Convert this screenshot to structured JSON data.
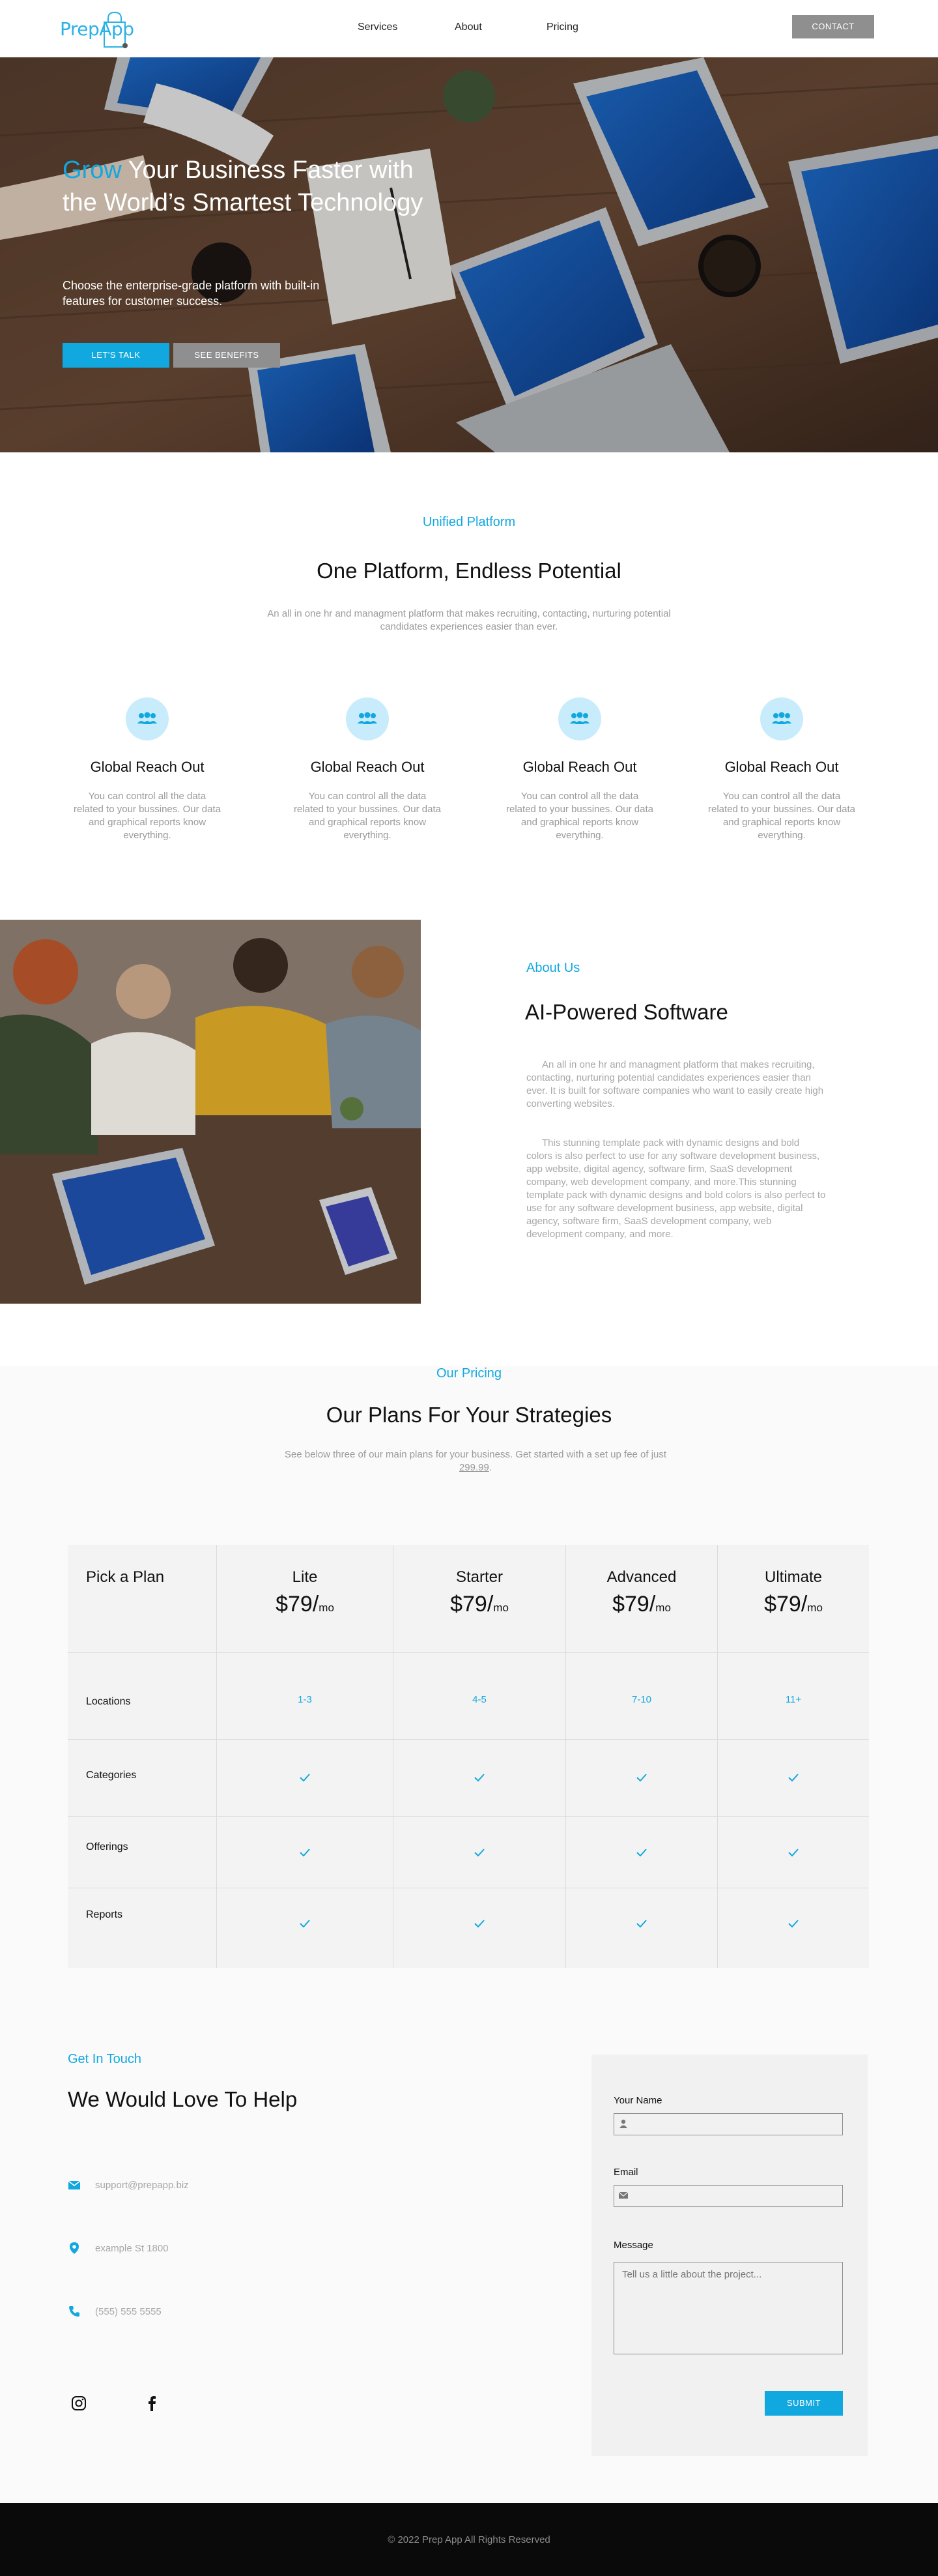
{
  "nav": {
    "logo_text": "PrepApp",
    "links": [
      "Services",
      "About",
      "Pricing"
    ],
    "contact_label": "CONTACT"
  },
  "hero": {
    "title_highlight": "Grow",
    "title_rest": " Your Business Faster with the World’s Smartest Technology",
    "subtitle": "Choose the enterprise-grade platform with built-in features for customer success.",
    "primary_button": "LET'S TALK",
    "secondary_button": "SEE BENEFITS"
  },
  "unified": {
    "eyebrow": "Unified Platform",
    "title": "One Platform, Endless Potential",
    "description": "An all in one hr and managment platform that makes recruiting, contacting, nurturing potential candidates experiences easier than ever.",
    "features": [
      {
        "title": "Global Reach Out",
        "desc": "You can control all the data related to your bussines.  Our data and graphical reports know everything.",
        "icon": "team-icon"
      },
      {
        "title": "Global Reach Out",
        "desc": "You can control all the data related to your bussines.  Our data and graphical reports know everything.",
        "icon": "team-icon"
      },
      {
        "title": "Global Reach Out",
        "desc": "You can control all the data related to your bussines.  Our data and graphical reports know everything.",
        "icon": "team-icon"
      },
      {
        "title": "Global Reach Out",
        "desc": "You can control all the data related to your bussines.  Our data and graphical reports know everything.",
        "icon": "team-icon"
      }
    ]
  },
  "about": {
    "eyebrow": "About Us",
    "title": "AI-Powered Software",
    "paragraph1": "An all in one hr and managment platform that makes recruiting, contacting, nurturing potential candidates experiences easier than ever. It is built for software companies who want to easily create high converting websites.",
    "paragraph2": "This stunning template pack with dynamic designs and bold colors is also perfect to use for any software development business, app website, digital agency, software firm, SaaS development company, web development company, and more.This stunning template pack with dynamic designs and bold colors is also perfect to use for any software development business, app website, digital agency, software firm, SaaS development company, web development company, and more."
  },
  "pricing": {
    "eyebrow": "Our Pricing",
    "title": "Our Plans For Your Strategies",
    "description_pre": "See below three of our main plans for your business. Get started with a set up fee of just ",
    "description_fee": "299.99",
    "description_post": ".",
    "pick_label": "Pick a Plan",
    "plans": [
      {
        "name": "Lite",
        "price": "$79/",
        "unit": "mo",
        "locations": "1-3"
      },
      {
        "name": "Starter",
        "price": "$79/",
        "unit": "mo",
        "locations": "4-5"
      },
      {
        "name": "Advanced",
        "price": "$79/",
        "unit": "mo",
        "locations": "7-10"
      },
      {
        "name": "Ultimate",
        "price": "$79/",
        "unit": "mo",
        "locations": "11+"
      }
    ],
    "rows": [
      "Locations",
      "Categories",
      "Offerings",
      "Reports"
    ]
  },
  "contact": {
    "eyebrow": "Get In Touch",
    "title": "We Would Love To Help",
    "email": "support@prepapp.biz",
    "address": "example St 1800",
    "phone": "(555) 555 5555",
    "form": {
      "name_label": "Your Name",
      "email_label": "Email",
      "message_label": "Message",
      "message_placeholder": "Tell us a little about the project...",
      "submit_label": "SUBMIT"
    }
  },
  "footer": {
    "text": "© 2022 Prep App All Rights  Reserved"
  },
  "colors": {
    "accent": "#11a8e0",
    "muted_text": "#9a9a9a",
    "button_gray": "#8f8f8f",
    "footer_bg": "#0a0a0a"
  }
}
